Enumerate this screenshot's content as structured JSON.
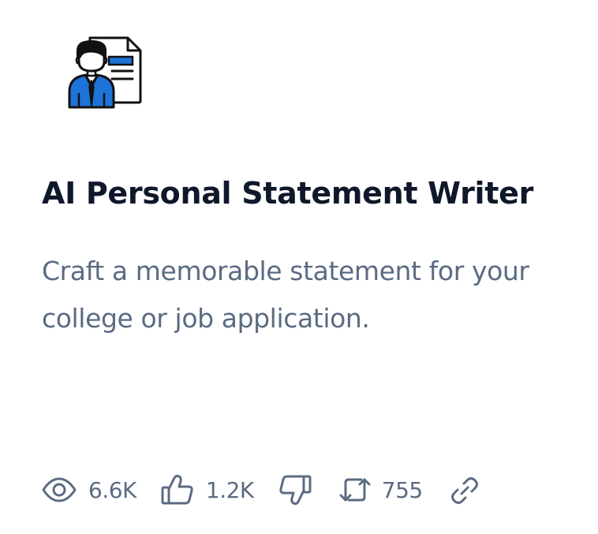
{
  "card": {
    "title": "AI Personal Statement Writer",
    "description": "Craft a memorable statement for your college or job application.",
    "icon": "person-with-document-icon"
  },
  "stats": {
    "views": "6.6K",
    "likes": "1.2K",
    "shares": "755"
  },
  "icons": {
    "views": "eye-icon",
    "likes": "thumbs-up-icon",
    "dislikes": "thumbs-down-icon",
    "shares": "repost-icon",
    "link": "link-icon"
  },
  "colors": {
    "title": "#0f172a",
    "text": "#5b6b83",
    "accent": "#1e73d8"
  }
}
